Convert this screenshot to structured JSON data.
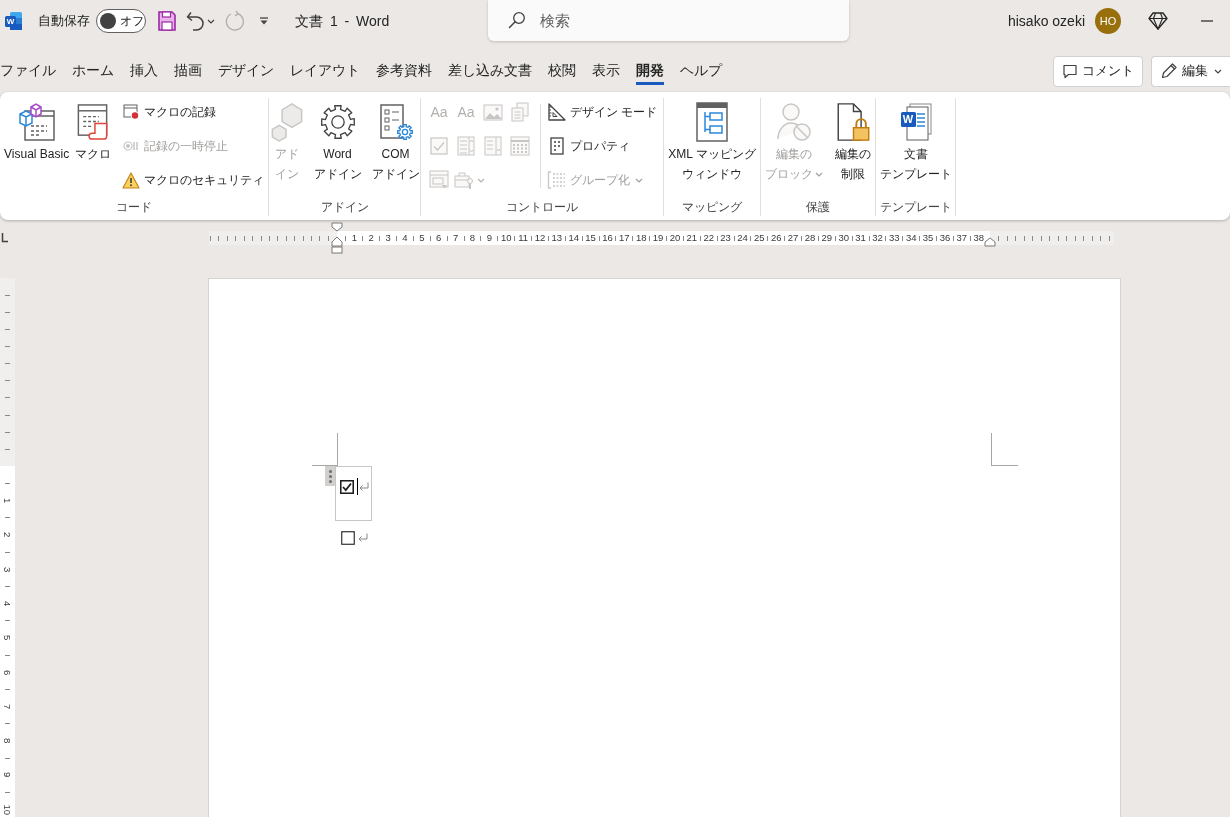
{
  "title_bar": {
    "app_logo": "W",
    "autosave_label": "自動保存",
    "autosave_toggle": {
      "text": "オフ",
      "on": false
    },
    "quick_access": [
      {
        "kind": "save",
        "disabled": false
      },
      {
        "kind": "undo",
        "disabled": false,
        "dropdown": true
      },
      {
        "kind": "redo",
        "disabled": true
      },
      {
        "kind": "customize",
        "disabled": false
      }
    ],
    "document_title": "文書 1 - Word",
    "search": {
      "placeholder": "検索"
    },
    "user_name": "hisako ozeki",
    "user_initials": "HO"
  },
  "tabs": [
    {
      "label": "ファイル",
      "selected": false
    },
    {
      "label": "ホーム",
      "selected": false
    },
    {
      "label": "挿入",
      "selected": false
    },
    {
      "label": "描画",
      "selected": false
    },
    {
      "label": "デザイン",
      "selected": false
    },
    {
      "label": "レイアウト",
      "selected": false
    },
    {
      "label": "参考資料",
      "selected": false
    },
    {
      "label": "差し込み文書",
      "selected": false
    },
    {
      "label": "校閲",
      "selected": false
    },
    {
      "label": "表示",
      "selected": false
    },
    {
      "label": "開発",
      "selected": true
    },
    {
      "label": "ヘルプ",
      "selected": false
    }
  ],
  "tab_actions": [
    {
      "kind": "comment",
      "label": "コメント"
    },
    {
      "kind": "edit",
      "label": "編集",
      "dropdown": true
    }
  ],
  "ribbon": {
    "groups": [
      {
        "label": "コード",
        "large_buttons": [
          {
            "kind": "vba",
            "label": [
              "Visual Basic"
            ],
            "disabled": false
          },
          {
            "kind": "macros",
            "label": [
              "マクロ"
            ],
            "disabled": false
          }
        ],
        "small_buttons": [
          {
            "kind": "record",
            "label": "マクロの記録",
            "disabled": false
          },
          {
            "kind": "pause",
            "label": "記録の一時停止",
            "disabled": true
          },
          {
            "kind": "security",
            "label": "マクロのセキュリティ",
            "disabled": false
          }
        ]
      },
      {
        "label": "アドイン",
        "large_buttons": [
          {
            "kind": "addins",
            "label": [
              "アド",
              "イン"
            ],
            "disabled": true
          },
          {
            "kind": "wordaddins",
            "label": [
              "Word",
              "アドイン"
            ],
            "disabled": false
          },
          {
            "kind": "comaddins",
            "label": [
              "COM",
              "アドイン"
            ],
            "disabled": false
          }
        ]
      },
      {
        "label": "コントロール",
        "icon_buttons": [
          {
            "kind": "richtext",
            "label": "Aa",
            "disabled": true
          },
          {
            "kind": "plaintext",
            "label": "Aa",
            "disabled": true
          },
          {
            "kind": "picture",
            "disabled": true
          },
          {
            "kind": "gallery",
            "disabled": true
          },
          {
            "kind": "checkbox",
            "disabled": true
          },
          {
            "kind": "combobox",
            "disabled": true
          },
          {
            "kind": "dropdown",
            "disabled": true
          },
          {
            "kind": "datepicker",
            "disabled": true
          },
          {
            "kind": "repeating",
            "disabled": true
          },
          {
            "kind": "legacy",
            "disabled": true,
            "dropdown": true
          }
        ],
        "small_buttons": [
          {
            "kind": "designmode",
            "label": "デザイン モード",
            "disabled": false
          },
          {
            "kind": "properties",
            "label": "プロパティ",
            "disabled": false
          },
          {
            "kind": "group",
            "label": "グループ化",
            "disabled": true,
            "dropdown": true
          }
        ]
      },
      {
        "label": "マッピング",
        "large_buttons": [
          {
            "kind": "xmlmapping",
            "label": [
              "XML マッピング",
              "ウィンドウ"
            ],
            "disabled": false
          }
        ]
      },
      {
        "label": "保護",
        "large_buttons": [
          {
            "kind": "blockauthors",
            "label": [
              "編集の",
              "ブロック"
            ],
            "disabled": true,
            "dropdown": true
          },
          {
            "kind": "restrict",
            "label": [
              "編集の",
              "制限"
            ],
            "disabled": false
          }
        ]
      },
      {
        "label": "テンプレート",
        "large_buttons": [
          {
            "kind": "template",
            "label": [
              "文書",
              "テンプレート"
            ],
            "logo_letter": "W",
            "disabled": false
          }
        ]
      }
    ]
  },
  "ruler": {
    "numbers": [
      "1",
      "2",
      "3",
      "4",
      "5",
      "6",
      "7",
      "8",
      "9",
      "10",
      "11",
      "12",
      "13",
      "14",
      "15",
      "16",
      "17",
      "18",
      "19",
      "20",
      "21",
      "22",
      "23",
      "24",
      "25",
      "26",
      "27",
      "28",
      "29",
      "30",
      "31",
      "32",
      "33",
      "34",
      "35",
      "36",
      "37",
      "38"
    ]
  },
  "vertical_ruler": {
    "numbers": [
      "1",
      "2",
      "3",
      "4",
      "5",
      "6",
      "7",
      "8",
      "9",
      "10"
    ]
  },
  "document": {
    "lines": [
      {
        "checked": true,
        "content_control": true,
        "cursor": true
      },
      {
        "checked": false,
        "content_control": false,
        "cursor": false
      }
    ]
  }
}
